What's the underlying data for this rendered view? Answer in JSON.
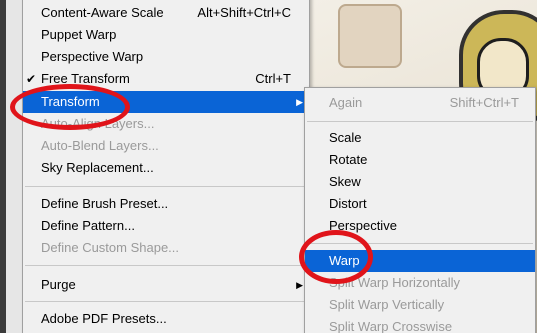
{
  "main_menu": {
    "items": [
      {
        "label": "Content-Aware Scale",
        "shortcut": "Alt+Shift+Ctrl+C",
        "state": "normal"
      },
      {
        "label": "Puppet Warp",
        "state": "normal"
      },
      {
        "label": "Perspective Warp",
        "state": "normal"
      },
      {
        "label": "Free Transform",
        "shortcut": "Ctrl+T",
        "state": "normal",
        "checked": true
      },
      {
        "label": "Transform",
        "state": "highlight",
        "has_submenu": true
      },
      {
        "label": "Auto-Align Layers...",
        "state": "disabled"
      },
      {
        "label": "Auto-Blend Layers...",
        "state": "disabled"
      },
      {
        "label": "Sky Replacement...",
        "state": "normal"
      },
      {
        "label": "Define Brush Preset...",
        "state": "normal"
      },
      {
        "label": "Define Pattern...",
        "state": "normal"
      },
      {
        "label": "Define Custom Shape...",
        "state": "disabled"
      },
      {
        "label": "Purge",
        "state": "normal",
        "has_submenu": true
      },
      {
        "label": "Adobe PDF Presets...",
        "state": "normal"
      }
    ]
  },
  "sub_menu": {
    "items": [
      {
        "label": "Again",
        "shortcut": "Shift+Ctrl+T",
        "state": "disabled"
      },
      {
        "label": "Scale",
        "state": "normal"
      },
      {
        "label": "Rotate",
        "state": "normal"
      },
      {
        "label": "Skew",
        "state": "normal"
      },
      {
        "label": "Distort",
        "state": "normal"
      },
      {
        "label": "Perspective",
        "state": "normal"
      },
      {
        "label": "Warp",
        "state": "highlight"
      },
      {
        "label": "Split Warp Horizontally",
        "state": "disabled"
      },
      {
        "label": "Split Warp Vertically",
        "state": "disabled"
      },
      {
        "label": "Split Warp Crosswise",
        "state": "disabled"
      }
    ]
  },
  "glyphs": {
    "check": "✔",
    "submenu_arrow": "▶"
  },
  "colors": {
    "highlight": "#0a64d6",
    "annotation": "#e0141a",
    "disabled_text": "#9a9a9a"
  }
}
